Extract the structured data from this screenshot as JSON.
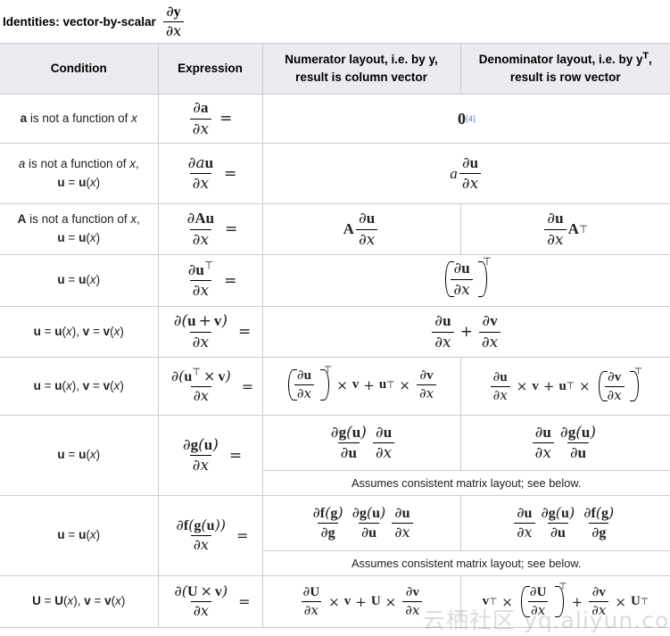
{
  "caption": {
    "prefix": "Identities: vector-by-scalar",
    "formula_num": "∂y",
    "formula_den": "∂x"
  },
  "table": {
    "headers": [
      "Condition",
      "Expression",
      "Numerator layout, i.e. by y, result is column vector",
      "Denominator layout, i.e. by yᵀ, result is row vector"
    ],
    "headers_detail": {
      "numerator_line1": "Numerator layout, i.e. by y,",
      "numerator_line2": "result is column vector",
      "denominator_line1_a": "Denominator layout, i.e. by y",
      "denominator_line1_sup": "T",
      "denominator_line1_b": ",",
      "denominator_line2": "result is row vector"
    },
    "rows": [
      {
        "condition_line1": "a is not a function of x",
        "condition_line2": "",
        "expression": "∂a / ∂x =",
        "merged": true,
        "result": "0",
        "result_ref": "[4]",
        "note": ""
      },
      {
        "condition_line1": "a is not a function of x,",
        "condition_line2": "u = u(x)",
        "expression": "∂au / ∂x =",
        "merged": true,
        "result": "a ∂u/∂x",
        "note": ""
      },
      {
        "condition_line1": "A is not a function of x,",
        "condition_line2": "u = u(x)",
        "expression": "∂Au / ∂x =",
        "merged": false,
        "numerator": "A ∂u/∂x",
        "denominator": "∂u/∂x Aᵀ",
        "note": ""
      },
      {
        "condition_line1": "u = u(x)",
        "condition_line2": "",
        "expression": "∂uᵀ / ∂x =",
        "merged": true,
        "result": "(∂u/∂x)ᵀ",
        "note": ""
      },
      {
        "condition_line1": "u = u(x), v = v(x)",
        "condition_line2": "",
        "expression": "∂(u + v) / ∂x =",
        "merged": true,
        "result": "∂u/∂x + ∂v/∂x",
        "note": ""
      },
      {
        "condition_line1": "u = u(x), v = v(x)",
        "condition_line2": "",
        "expression": "∂(uᵀ × v) / ∂x =",
        "merged": false,
        "numerator": "(∂u/∂x)ᵀ × v + uᵀ × ∂v/∂x",
        "denominator": "∂u/∂x × v + uᵀ × (∂v/∂x)ᵀ",
        "note": ""
      },
      {
        "condition_line1": "u = u(x)",
        "condition_line2": "",
        "expression": "∂g(u) / ∂x =",
        "merged": false,
        "numerator": "∂g(u)/∂u ∂u/∂x",
        "denominator": "∂u/∂x ∂g(u)/∂u",
        "note": "Assumes consistent matrix layout; see below."
      },
      {
        "condition_line1": "u = u(x)",
        "condition_line2": "",
        "expression": "∂f(g(u)) / ∂x =",
        "merged": false,
        "numerator": "∂f(g)/∂g ∂g(u)/∂u ∂u/∂x",
        "denominator": "∂u/∂x ∂g(u)/∂u ∂f(g)/∂g",
        "note": "Assumes consistent matrix layout; see below."
      },
      {
        "condition_line1": "U = U(x), v = v(x)",
        "condition_line2": "",
        "expression": "∂(U × v) / ∂x =",
        "merged": false,
        "numerator": "∂U/∂x × v + U × ∂v/∂x",
        "denominator": "vᵀ × (∂U/∂x)ᵀ + ∂v/∂x × Uᵀ",
        "note": ""
      }
    ],
    "notes": {
      "assumes": "Assumes consistent matrix layout; see below."
    }
  },
  "watermark": {
    "text": "云栖社区 yq.aliyun.com"
  },
  "colors": {
    "header_bg": "#eaecf0",
    "border": "#c8ccd1",
    "text": "#202122",
    "reference_link": "#3366cc"
  }
}
